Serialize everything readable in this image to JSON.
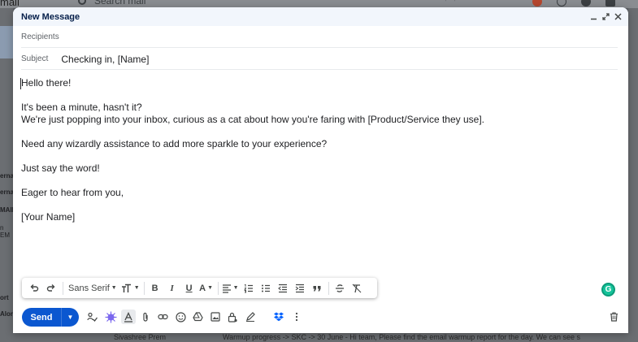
{
  "background": {
    "app_name": "mail",
    "search_placeholder": "Search mail",
    "sidebar_fragments": [
      "erna",
      "erna",
      "MAIL",
      "n EM",
      "ort",
      "Alon"
    ],
    "row_sender": "Sivashree Prem",
    "row_snippet": "Warmup progress -> SKC -> 30 June - Hi team, Please find the email warmup report for the day. We can see s"
  },
  "compose": {
    "title": "New Message",
    "header_icons": [
      "minimize-icon",
      "pop-out-icon",
      "close-icon"
    ],
    "recipients_placeholder": "Recipients",
    "subject_label": "Subject",
    "subject_value": "Checking in, [Name]",
    "body": {
      "line1": "Hello there!",
      "line2": "It's been a minute, hasn't it?",
      "line3": "We're just popping into your inbox, curious as a cat about how you're faring with [Product/Service they use].",
      "line4": "Need any wizardly assistance to add more sparkle to your experience?",
      "line5": "Just say the word!",
      "line6": "Eager to hear from you,",
      "line7": "[Your Name]"
    },
    "toolbar": {
      "font_name": "Sans Serif",
      "bold": "B",
      "italic": "I",
      "underline": "U",
      "text_color": "A"
    },
    "grammarly_badge": "G",
    "send_label": "Send"
  },
  "colors": {
    "accent": "#0b57d0",
    "header_bg": "#f2f6fc",
    "grammarly": "#15c39a",
    "ai_icon": "#7b68ee",
    "dropbox": "#0061fe"
  }
}
